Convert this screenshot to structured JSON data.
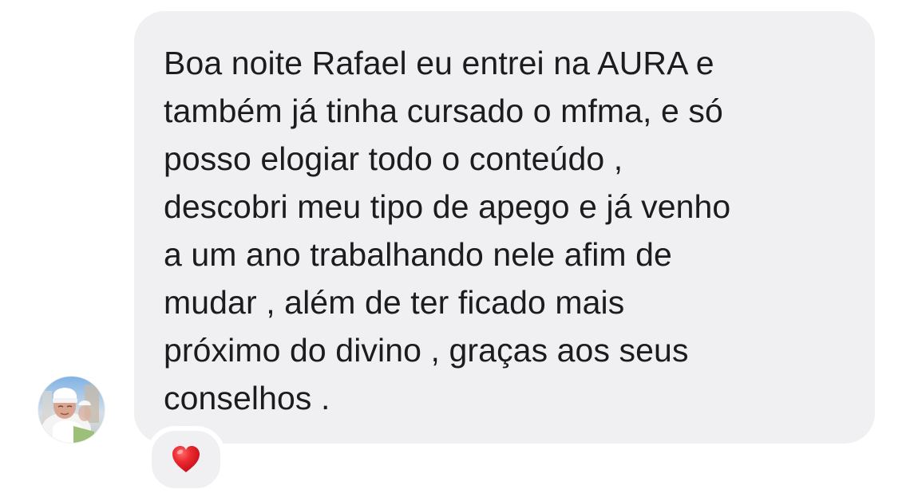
{
  "message": {
    "text": "Boa noite Rafael eu entrei na AURA e\ntambém já tinha cursado o mfma, e só\nposso elogiar todo o conteúdo ,\ndescobri meu tipo de apego e já venho\na um ano  trabalhando  nele afim de\nmudar  , além de ter ficado mais\npróximo do divino , graças aos seus\nconselhos ."
  },
  "reaction": {
    "icon": "heart-icon",
    "color": "#e0141e"
  },
  "colors": {
    "bubble": "#f0f0f3",
    "text": "#1c1c1e"
  }
}
